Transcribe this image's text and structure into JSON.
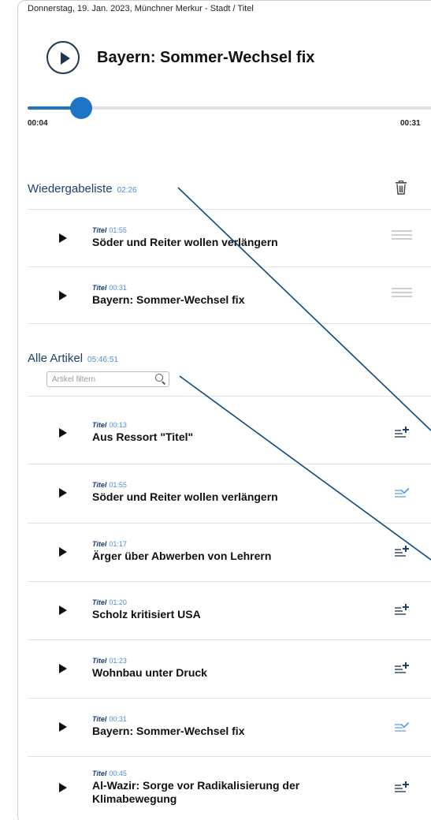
{
  "header": {
    "dateline": "Donnerstag, 19. Jan. 2023, Münchner Merkur - Stadt / Titel"
  },
  "player": {
    "title": "Bayern: Sommer-Wechsel fix",
    "current_time": "00:04",
    "total_time": "00:31",
    "progress": 0.13
  },
  "playlist": {
    "title": "Wiedergabeliste",
    "total": "02:26",
    "items": [
      {
        "category": "Titel",
        "duration": "01:55",
        "title": "Söder und Reiter wollen verlängern"
      },
      {
        "category": "Titel",
        "duration": "00:31",
        "title": "Bayern: Sommer-Wechsel fix"
      }
    ]
  },
  "articles": {
    "title": "Alle Artikel",
    "total": "05:46:51",
    "filter_placeholder": "Artikel filtern",
    "items": [
      {
        "category": "Titel",
        "duration": "00:13",
        "title": "Aus Ressort \"Titel\"",
        "in_playlist": false
      },
      {
        "category": "Titel",
        "duration": "01:55",
        "title": "Söder und Reiter wollen verlängern",
        "in_playlist": true
      },
      {
        "category": "Titel",
        "duration": "01:17",
        "title": "Ärger über Abwerben von Lehrern",
        "in_playlist": false
      },
      {
        "category": "Titel",
        "duration": "01:20",
        "title": "Scholz kritisiert USA",
        "in_playlist": false
      },
      {
        "category": "Titel",
        "duration": "01:23",
        "title": "Wohnbau unter Druck",
        "in_playlist": false
      },
      {
        "category": "Titel",
        "duration": "00:31",
        "title": "Bayern: Sommer-Wechsel fix",
        "in_playlist": true
      },
      {
        "category": "Titel",
        "duration": "00:45",
        "title": "Al-Wazir: Sorge vor Radikalisierung der Klimabewegung",
        "in_playlist": false
      }
    ]
  },
  "colors": {
    "accent": "#1e74c4",
    "navy": "#1e3553",
    "time_blue": "#4d8fd6"
  },
  "icons": {
    "trash": "trash-icon",
    "drag": "drag-handle-icon",
    "add": "add-to-playlist-icon",
    "added": "added-to-playlist-icon",
    "search": "search-icon",
    "play": "play-icon"
  }
}
